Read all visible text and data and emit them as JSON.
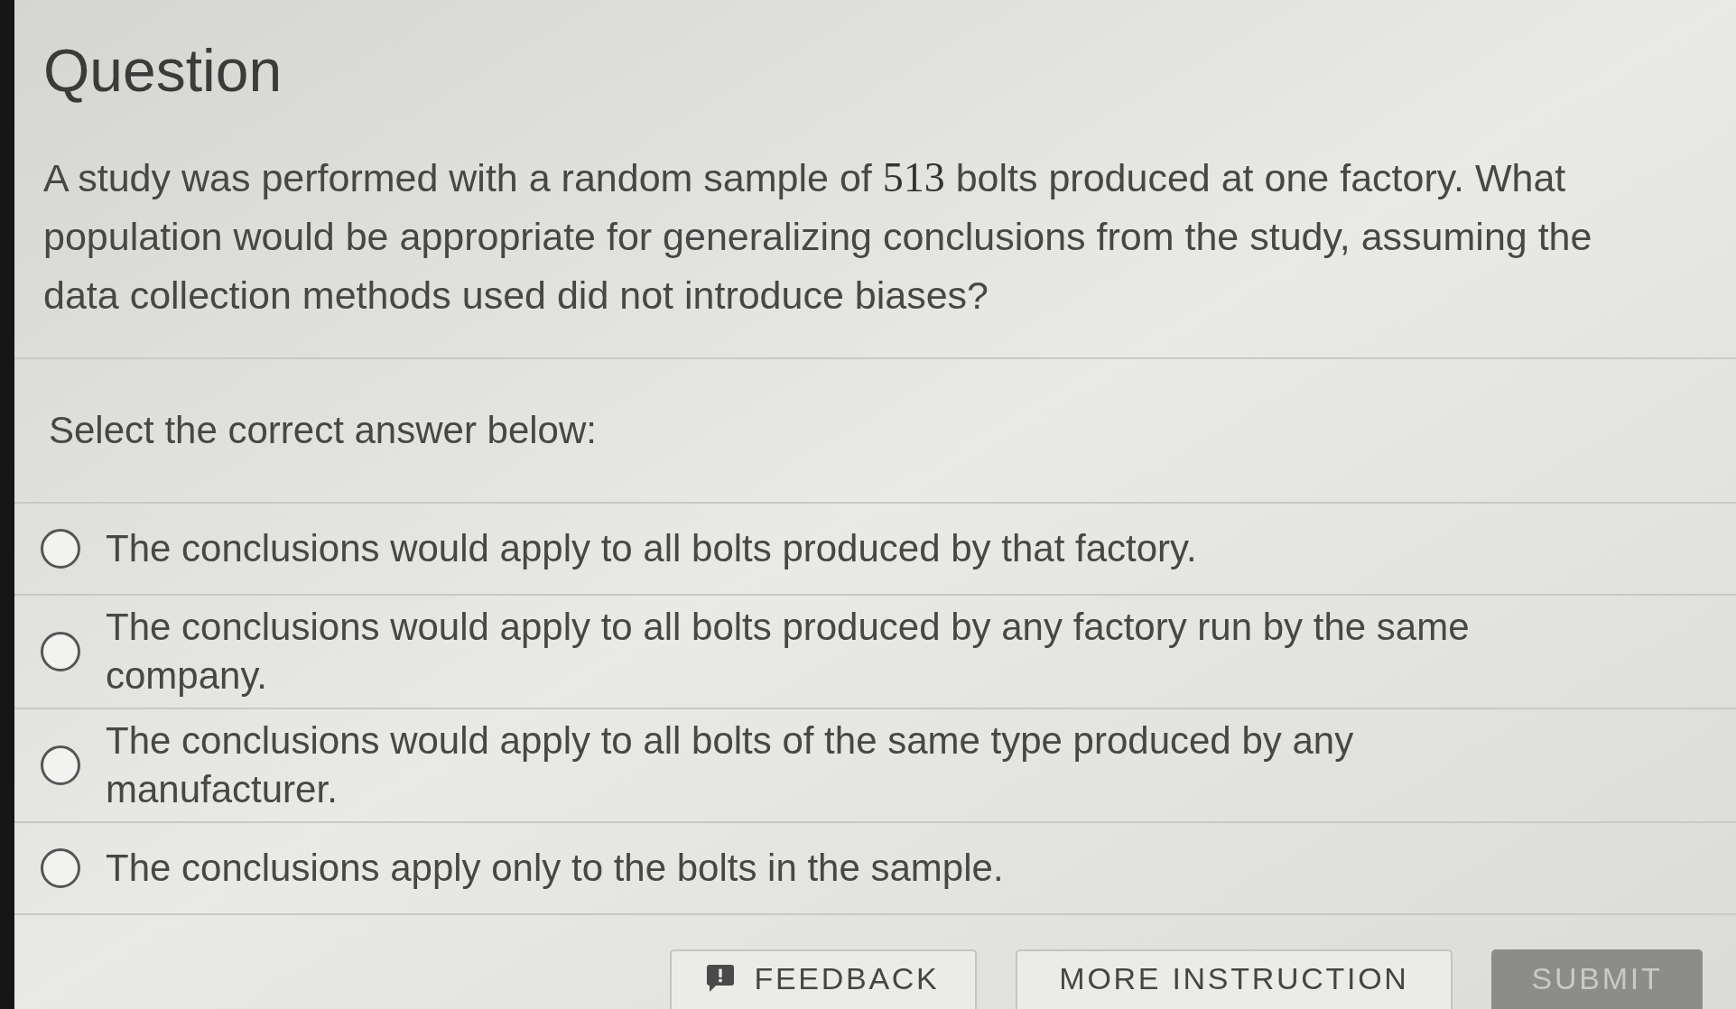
{
  "question": {
    "title": "Question",
    "prompt": [
      {
        "kind": "text",
        "text": "A study was performed with a random sample of "
      },
      {
        "kind": "math",
        "text": "513"
      },
      {
        "kind": "text",
        "text": " bolts produced at one factory. What population would be appropriate for generalizing conclusions from the study, assuming the data collection methods used did not introduce biases?"
      }
    ]
  },
  "answer_section": {
    "instruction": "Select the correct answer below:",
    "options": [
      {
        "text": "The conclusions would apply to all bolts produced by that factory.",
        "selected": false
      },
      {
        "text": "The conclusions would apply to all bolts produced by any factory run by the same company.",
        "selected": false
      },
      {
        "text": "The conclusions would apply to all bolts of the same type produced by any manufacturer.",
        "selected": false
      },
      {
        "text": "The conclusions apply only to the bolts in the sample.",
        "selected": false
      }
    ]
  },
  "buttons": [
    {
      "kind": "feedback",
      "label": "FEEDBACK",
      "disabled": false
    },
    {
      "kind": "outline",
      "label": "MORE INSTRUCTION",
      "disabled": false
    },
    {
      "kind": "submit",
      "label": "SUBMIT",
      "disabled": true
    }
  ]
}
